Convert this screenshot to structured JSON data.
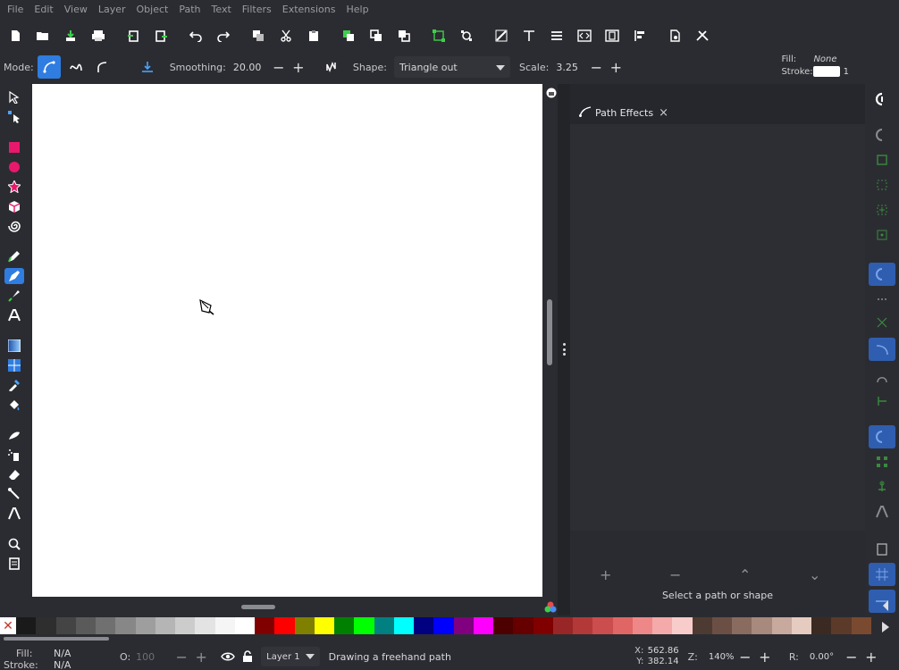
{
  "menu": [
    "File",
    "Edit",
    "View",
    "Layer",
    "Object",
    "Path",
    "Text",
    "Filters",
    "Extensions",
    "Help"
  ],
  "commands": [
    "new-document-icon",
    "open-icon",
    "save-icon",
    "print-icon",
    "import-icon",
    "export-icon",
    "undo-icon",
    "redo-icon",
    "duplicate-icon",
    "cut-icon",
    "paste-icon",
    "group-icon",
    "clone-icon",
    "unlink-clone-icon",
    "node-select-icon",
    "object-to-path-icon",
    "edit-path-icon",
    "text-tool-icon",
    "align-icon",
    "xml-editor-icon",
    "objects-panel-icon",
    "layers-panel-icon",
    "document-properties-icon",
    "preferences-icon"
  ],
  "tool_controls": {
    "mode_label": "Mode:",
    "smoothing_label": "Smoothing:",
    "smoothing_value": "20.00",
    "shape_label": "Shape:",
    "shape_value": "Triangle out",
    "scale_label": "Scale:",
    "scale_value": "3.25",
    "minus": "−",
    "plus": "+"
  },
  "style_indicator": {
    "fill_label": "Fill:",
    "fill_value": "None",
    "stroke_label": "Stroke:",
    "stroke_width": "1"
  },
  "panel": {
    "tab_label": "Path Effects",
    "close_glyph": "×",
    "status": "Select a path or shape",
    "add_glyph": "+",
    "remove_glyph": "−",
    "up_glyph": "⌃",
    "down_glyph": "⌄"
  },
  "statusbar": {
    "fill_label": "Fill:",
    "fill_value": "N/A",
    "stroke_label": "Stroke:",
    "stroke_value": "N/A",
    "opacity_label": "O:",
    "opacity_value": "100",
    "layer": "Layer 1",
    "message": "Drawing a freehand path",
    "x_label": "X:",
    "x_value": "562.86",
    "y_label": "Y:",
    "y_value": "382.14",
    "zoom_label": "Z:",
    "zoom_value": "140%",
    "rotation_label": "R:",
    "rotation_value": "0.00°"
  },
  "palette": [
    "#1a1a1a",
    "#2e2e2e",
    "#444444",
    "#5a5a5a",
    "#707070",
    "#878787",
    "#9e9e9e",
    "#b5b5b5",
    "#cccccc",
    "#e3e3e3",
    "#f5f5f5",
    "#ffffff",
    "#800000",
    "#ff0000",
    "#808000",
    "#ffff00",
    "#008000",
    "#00ff00",
    "#008080",
    "#00ffff",
    "#000080",
    "#0000ff",
    "#800080",
    "#ff00ff",
    "#4d0000",
    "#660000",
    "#800000",
    "#992626",
    "#b33939",
    "#cc4d4d",
    "#e06666",
    "#ee8888",
    "#f4aaaa",
    "#f9cccc",
    "#4d3b33",
    "#6b4f45",
    "#8a6b5f",
    "#a8897d",
    "#c7a99e",
    "#e6cbc0",
    "#3a2a22",
    "#5c3a2a",
    "#7a4a30"
  ]
}
